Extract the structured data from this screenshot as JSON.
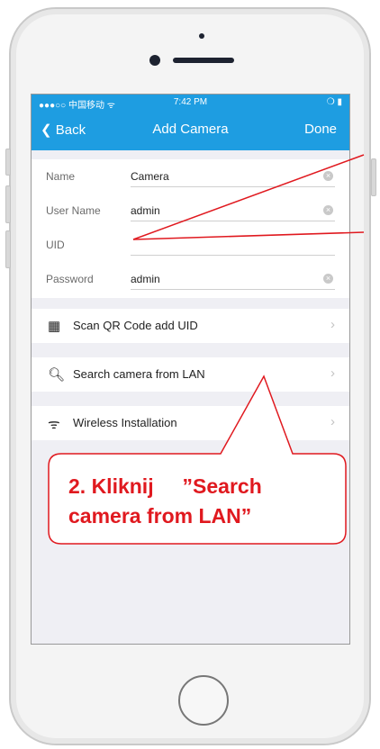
{
  "status_bar": {
    "carrier": "●●●○○ 中国移动 ᯤ",
    "time": "7:42 PM",
    "battery": "❍ ▮"
  },
  "nav": {
    "back_label": "Back",
    "title": "Add Camera",
    "done_label": "Done",
    "color": "#1e9de1"
  },
  "form": {
    "fields": [
      {
        "label": "Name",
        "value": "Camera"
      },
      {
        "label": "User Name",
        "value": "admin"
      },
      {
        "label": "UID",
        "value": ""
      },
      {
        "label": "Password",
        "value": "admin"
      }
    ]
  },
  "menu": {
    "items": [
      {
        "icon": "qr-code-icon",
        "label": "Scan QR Code add UID"
      },
      {
        "icon": "search-icon",
        "label": "Search camera from LAN"
      },
      {
        "icon": "wifi-icon",
        "label": "Wireless Installation"
      }
    ]
  },
  "annotation": {
    "text_line1": "2. Kliknij     ”Search",
    "text_line2": "camera from LAN”",
    "color": "#e0191f"
  }
}
